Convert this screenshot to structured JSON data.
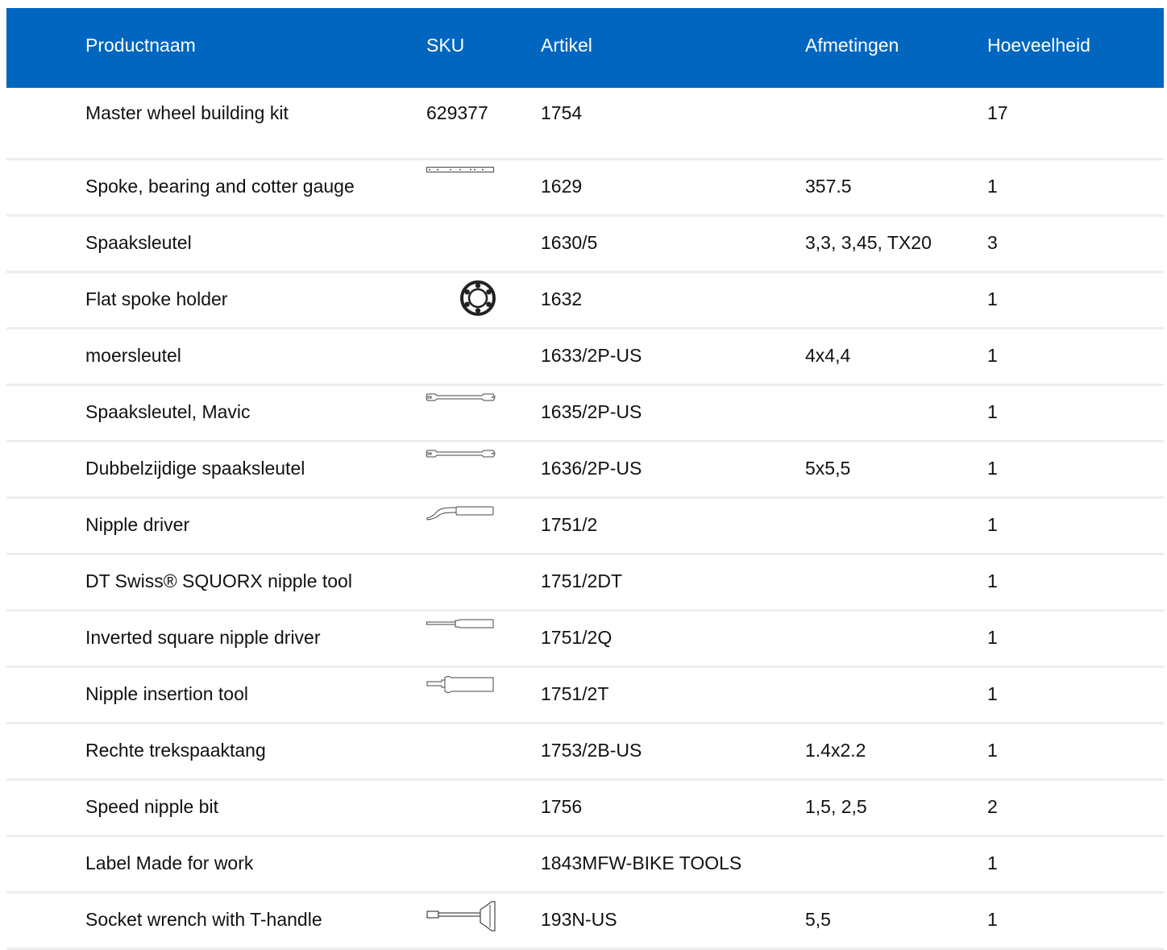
{
  "header": {
    "product_name": "Productnaam",
    "sku": "SKU",
    "article": "Artikel",
    "dimensions": "Afmetingen",
    "quantity": "Hoeveelheid"
  },
  "rows": [
    {
      "name": "Master wheel building kit",
      "sku": "629377",
      "article": "1754",
      "dimensions": "",
      "quantity": "17",
      "sku_icon": ""
    },
    {
      "name": "Spoke, bearing and cotter gauge",
      "sku": "",
      "article": "1629",
      "dimensions": "357.5",
      "quantity": "1",
      "sku_icon": "gauge-ruler-icon"
    },
    {
      "name": "Spaaksleutel",
      "sku": "",
      "article": "1630/5",
      "dimensions": "3,3, 3,45, TX20",
      "quantity": "3",
      "sku_icon": ""
    },
    {
      "name": "Flat spoke holder",
      "sku": "",
      "article": "1632",
      "dimensions": "",
      "quantity": "1",
      "sku_icon": "spoke-holder-ring-icon"
    },
    {
      "name": "moersleutel",
      "sku": "",
      "article": "1633/2P-US",
      "dimensions": "4x4,4",
      "quantity": "1",
      "sku_icon": ""
    },
    {
      "name": "Spaaksleutel, Mavic",
      "sku": "",
      "article": "1635/2P-US",
      "dimensions": "",
      "quantity": "1",
      "sku_icon": "spoke-wrench-icon"
    },
    {
      "name": "Dubbelzijdige spaaksleutel",
      "sku": "",
      "article": "1636/2P-US",
      "dimensions": "5x5,5",
      "quantity": "1",
      "sku_icon": "double-spoke-wrench-icon"
    },
    {
      "name": "Nipple driver",
      "sku": "",
      "article": "1751/2",
      "dimensions": "",
      "quantity": "1",
      "sku_icon": "nipple-driver-icon"
    },
    {
      "name": "DT Swiss® SQUORX nipple tool",
      "sku": "",
      "article": "1751/2DT",
      "dimensions": "",
      "quantity": "1",
      "sku_icon": ""
    },
    {
      "name": "Inverted square nipple driver",
      "sku": "",
      "article": "1751/2Q",
      "dimensions": "",
      "quantity": "1",
      "sku_icon": "screwdriver-icon"
    },
    {
      "name": "Nipple insertion tool",
      "sku": "",
      "article": "1751/2T",
      "dimensions": "",
      "quantity": "1",
      "sku_icon": "insertion-tool-icon"
    },
    {
      "name": "Rechte trekspaaktang",
      "sku": "",
      "article": "1753/2B-US",
      "dimensions": "1.4x2.2",
      "quantity": "1",
      "sku_icon": ""
    },
    {
      "name": "Speed nipple bit",
      "sku": "",
      "article": "1756",
      "dimensions": "1,5, 2,5",
      "quantity": "2",
      "sku_icon": ""
    },
    {
      "name": "Label Made for work",
      "sku": "",
      "article": "1843MFW-BIKE TOOLS",
      "dimensions": "",
      "quantity": "1",
      "sku_icon": ""
    },
    {
      "name": "Socket wrench with T-handle",
      "sku": "",
      "article": "193N-US",
      "dimensions": "5,5",
      "quantity": "1",
      "sku_icon": "t-handle-wrench-icon"
    }
  ]
}
